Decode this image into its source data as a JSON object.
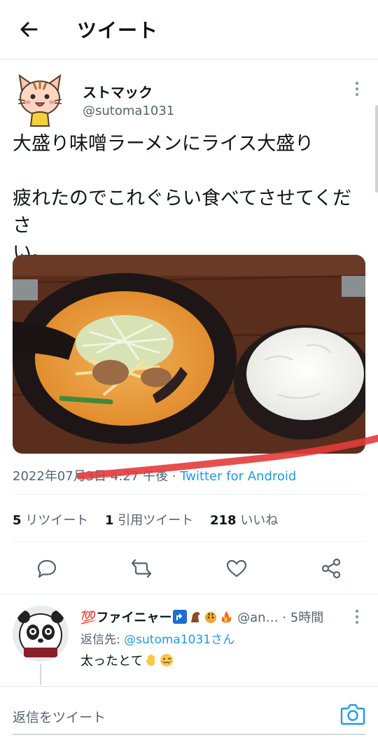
{
  "header": {
    "title": "ツイート"
  },
  "tweet": {
    "display_name": "ストマック",
    "handle": "@sutoma1031",
    "text_line1": "大盛り味噌ラーメンにライス大盛り",
    "text_line2": "疲れたのでこれぐらい食べてさせてくださ",
    "text_line3": "い。",
    "timestamp": "2022年07月3日 4:27 午後 · ",
    "source": "Twitter for Android",
    "retweets_count": "5",
    "retweets_label": "リツイート",
    "quotes_count": "1",
    "quotes_label": "引用ツイート",
    "likes_count": "218",
    "likes_label": "いいね"
  },
  "reply": {
    "name": "💯ファイニャー",
    "handle": "@an…",
    "time": "· 5時間",
    "reply_to_prefix": "返信先: ",
    "reply_to_handle": "@sutoma1031さん",
    "text": "太ったとて"
  },
  "composer": {
    "placeholder": "返信をツイート"
  },
  "colors": {
    "accent": "#1d9bf0",
    "secondary_text": "#536471",
    "primary_text": "#0f1419",
    "divider": "#eff3f4",
    "red_scribble": "#e43b3b"
  },
  "icons": [
    "back-arrow-icon",
    "more-icon",
    "reply-icon",
    "retweet-icon",
    "like-icon",
    "share-icon",
    "camera-icon"
  ]
}
